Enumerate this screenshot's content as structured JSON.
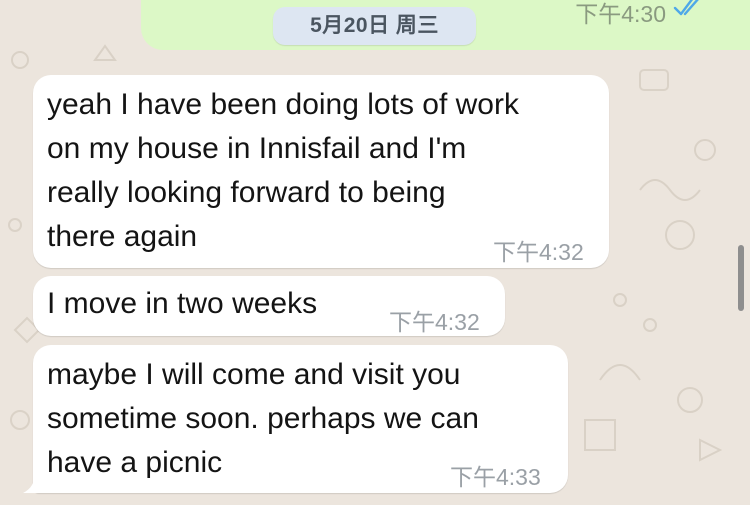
{
  "outgoing": {
    "time": "下午4:30",
    "status_icon": "read-double-check-icon"
  },
  "date_separator": "5月20日 周三",
  "messages": [
    {
      "lines": [
        "yeah I have been doing lots of work",
        "on my house in Innisfail and I'm",
        "really looking forward to being",
        "there again"
      ],
      "time": "下午4:32"
    },
    {
      "lines": [
        "I move in two weeks"
      ],
      "time": "下午4:32"
    },
    {
      "lines": [
        "maybe I will come and visit you",
        "sometime soon. perhaps we can",
        "have a picnic"
      ],
      "time": "下午4:33"
    }
  ],
  "colors": {
    "wallpaper": "#ece5dd",
    "outgoing_bubble": "#dcf8c6",
    "incoming_bubble": "#ffffff",
    "read_ticks": "#4fa8e8"
  }
}
